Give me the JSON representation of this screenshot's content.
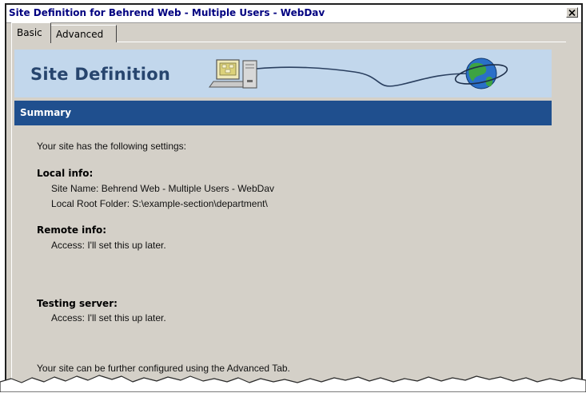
{
  "window": {
    "title": "Site Definition for Behrend Web - Multiple Users - WebDav",
    "close_glyph": "✕"
  },
  "tabs": [
    {
      "label": "Basic",
      "selected": true
    },
    {
      "label": "Advanced",
      "selected": false
    }
  ],
  "banner": {
    "title": "Site Definition"
  },
  "summary": {
    "heading": "Summary",
    "intro": "Your site has the following settings:",
    "local_info": {
      "heading": "Local info:",
      "site_name": "Site Name: Behrend Web - Multiple Users - WebDav",
      "local_root": "Local Root Folder: S:\\example-section\\department\\"
    },
    "remote_info": {
      "heading": "Remote info:",
      "access": "Access: I'll set this up later."
    },
    "testing_server": {
      "heading": "Testing server:",
      "access": "Access: I'll set this up later."
    },
    "footer": "Your site can be further configured using the Advanced Tab."
  },
  "colors": {
    "dialog_bg": "#d4d0c8",
    "banner_bg": "#c2d7ec",
    "summary_bar": "#1f4f8e",
    "title_text": "#000080"
  }
}
